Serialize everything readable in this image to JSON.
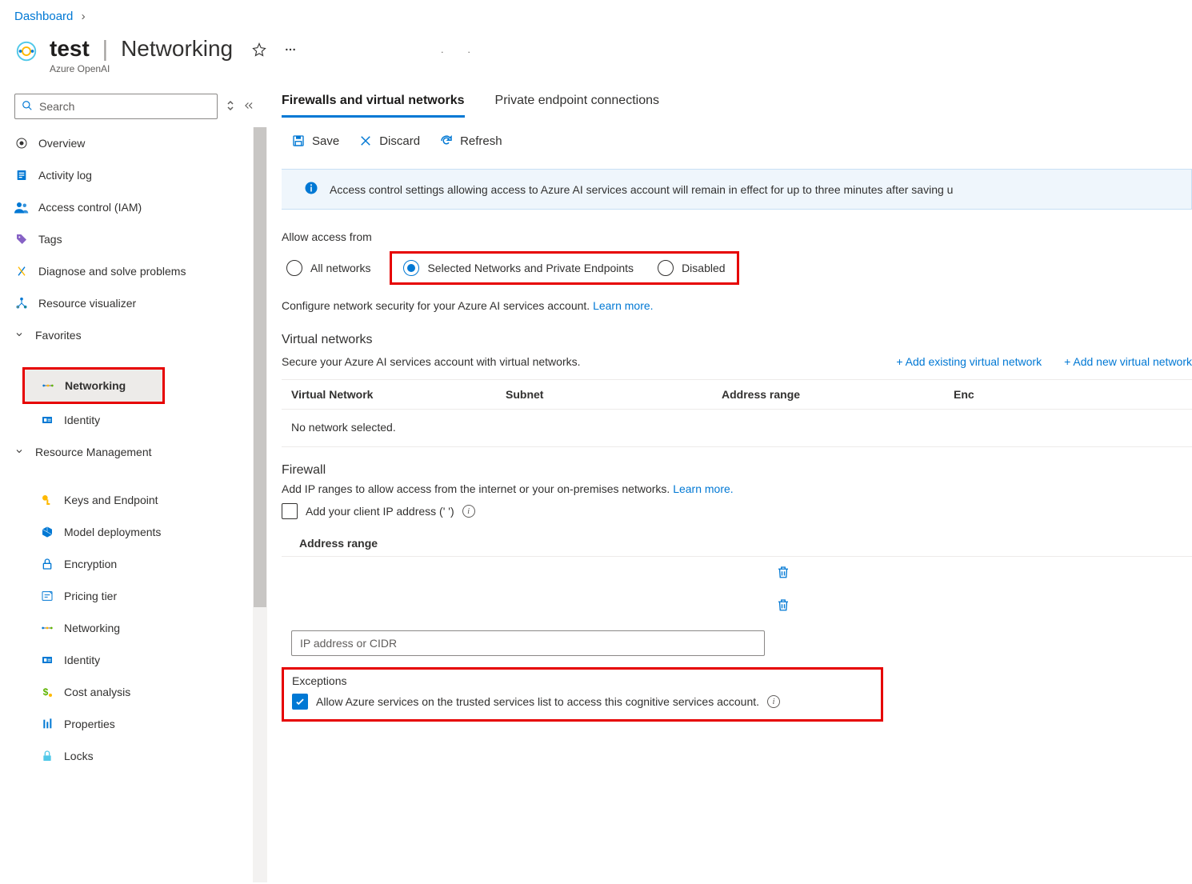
{
  "breadcrumb": {
    "dashboard": "Dashboard"
  },
  "header": {
    "resource_name": "test",
    "resource_type": "Azure OpenAI",
    "page_title": "Networking"
  },
  "search": {
    "placeholder": "Search"
  },
  "sidebar": {
    "items": {
      "overview": "Overview",
      "activity_log": "Activity log",
      "access_control": "Access control (IAM)",
      "tags": "Tags",
      "diagnose": "Diagnose and solve problems",
      "resource_visualizer": "Resource visualizer",
      "favorites": "Favorites",
      "networking_fav": "Networking",
      "identity_fav": "Identity",
      "resource_management": "Resource Management",
      "keys_endpoint": "Keys and Endpoint",
      "model_deployments": "Model deployments",
      "encryption": "Encryption",
      "pricing_tier": "Pricing tier",
      "networking": "Networking",
      "identity": "Identity",
      "cost_analysis": "Cost analysis",
      "properties": "Properties",
      "locks": "Locks"
    }
  },
  "tabs": {
    "firewalls": "Firewalls and virtual networks",
    "private_endpoints": "Private endpoint connections"
  },
  "toolbar": {
    "save": "Save",
    "discard": "Discard",
    "refresh": "Refresh"
  },
  "banner": "Access control settings allowing access to Azure AI services account will remain in effect for up to three minutes after saving u",
  "allow_access": {
    "label": "Allow access from",
    "all_networks": "All networks",
    "selected": "Selected Networks and Private Endpoints",
    "disabled": "Disabled",
    "desc_prefix": "Configure network security for your Azure AI services account. ",
    "learn_more": "Learn more."
  },
  "vnet": {
    "title": "Virtual networks",
    "desc": "Secure your Azure AI services account with virtual networks.",
    "add_existing": "+ Add existing virtual network",
    "add_new": "+ Add new virtual network",
    "col_vnet": "Virtual Network",
    "col_subnet": "Subnet",
    "col_range": "Address range",
    "col_endpoint": "Enc",
    "empty": "No network selected."
  },
  "firewall": {
    "title": "Firewall",
    "desc_prefix": "Add IP ranges to allow access from the internet or your on-premises networks. ",
    "learn_more": "Learn more.",
    "add_client_ip": "Add your client IP address ('                       ')",
    "col_range": "Address range",
    "ip_placeholder": "IP address or CIDR"
  },
  "exceptions": {
    "title": "Exceptions",
    "allow_trusted": "Allow Azure services on the trusted services list to access this cognitive services account."
  }
}
